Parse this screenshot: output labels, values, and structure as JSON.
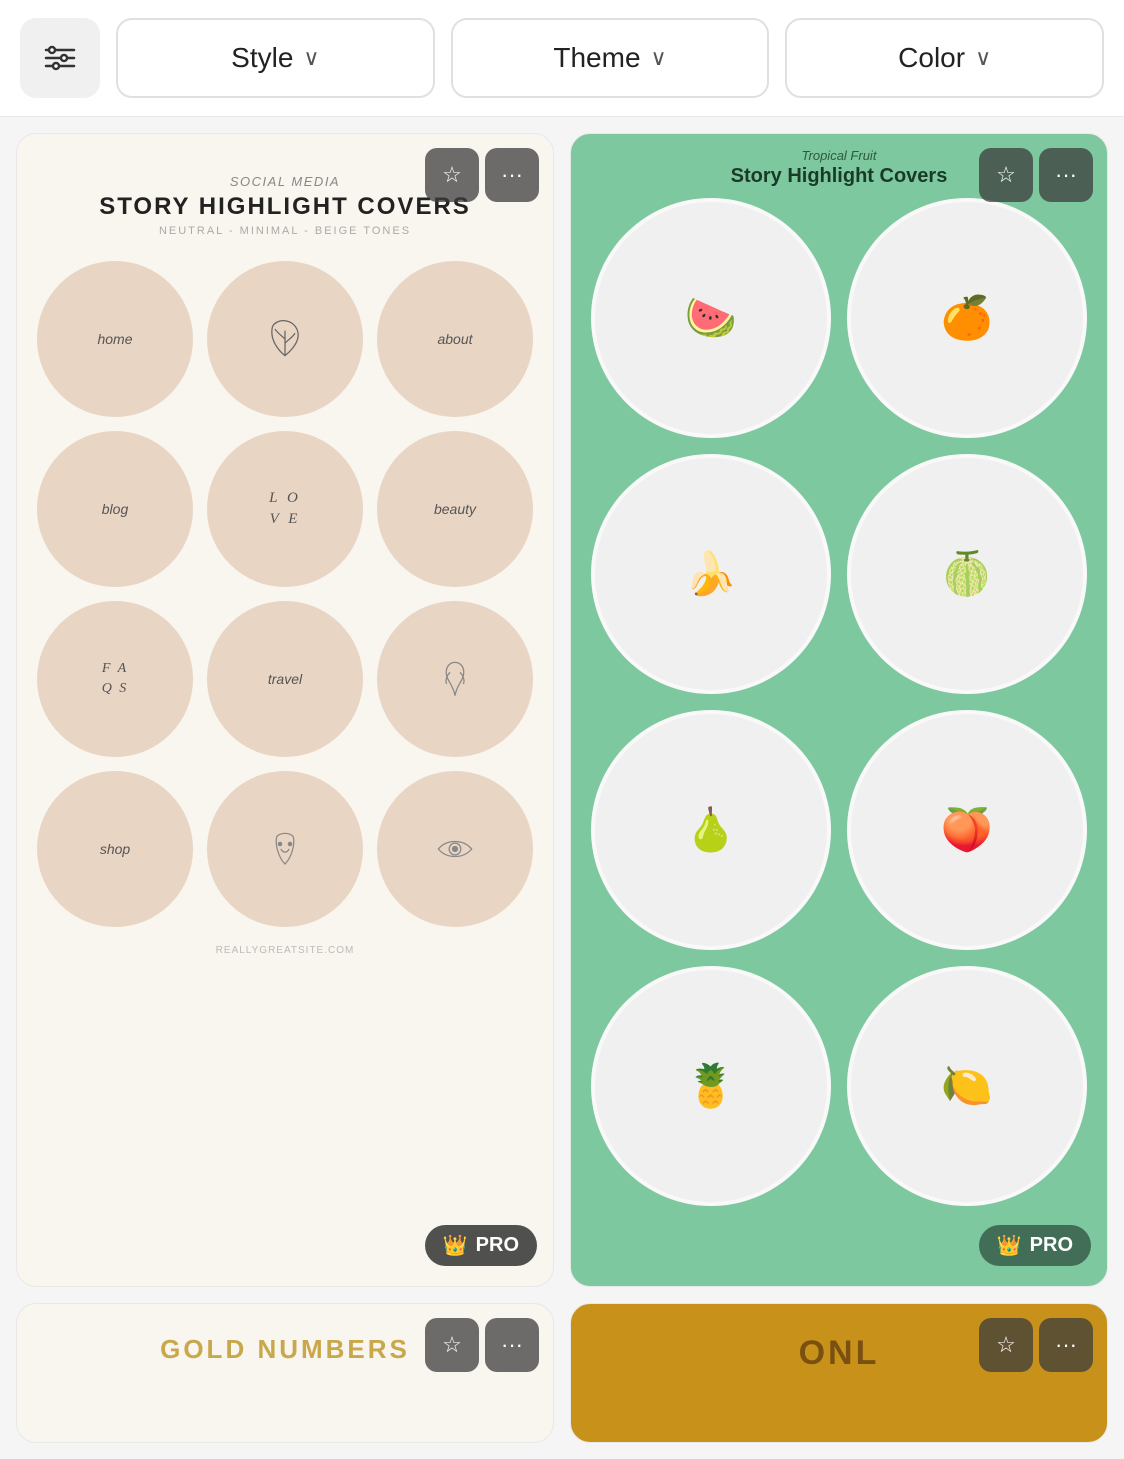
{
  "filterBar": {
    "iconBtn": {
      "ariaLabel": "Filters"
    },
    "buttons": [
      {
        "id": "style-btn",
        "label": "Style",
        "hasChevron": true
      },
      {
        "id": "theme-btn",
        "label": "Theme",
        "hasChevron": true
      },
      {
        "id": "color-btn",
        "label": "Color",
        "hasChevron": true
      }
    ]
  },
  "cards": [
    {
      "id": "card-neutral-highlights",
      "type": "neutral",
      "subtitle": "Social Media",
      "title": "STORY HIGHLIGHT COVERS",
      "description": "NEUTRAL - MINIMAL - BEIGE TONES",
      "footer": "REALLYGREATSITE.COM",
      "proBadge": "PRO",
      "circles": [
        {
          "label": "home",
          "type": "text"
        },
        {
          "label": "🌿",
          "type": "leaf"
        },
        {
          "label": "about",
          "type": "text"
        },
        {
          "label": "blog",
          "type": "text"
        },
        {
          "label": "LO\nVE",
          "type": "text-lines"
        },
        {
          "label": "beauty",
          "type": "text"
        },
        {
          "label": "FA\nQS",
          "type": "text-lines"
        },
        {
          "label": "travel",
          "type": "text"
        },
        {
          "label": "♡",
          "type": "body"
        },
        {
          "label": "shop",
          "type": "text"
        },
        {
          "label": "☽",
          "type": "face"
        },
        {
          "label": "👁",
          "type": "eye"
        }
      ]
    },
    {
      "id": "card-tropical-highlights",
      "type": "tropical",
      "subtitle": "Tropical Fruit",
      "title": "Story Highlight Covers",
      "proBadge": "PRO",
      "fruits": [
        "🍉",
        "🍊",
        "🍌",
        "🍈",
        "🍐",
        "🍑",
        "🍍",
        "🍋"
      ]
    },
    {
      "id": "card-gold-numbers",
      "type": "gold",
      "title": "GOLD NUMBERS",
      "proBadge": null
    },
    {
      "id": "card-onl",
      "type": "dark-gold",
      "title": "ONL",
      "proBadge": null
    }
  ],
  "actions": {
    "starLabel": "☆",
    "moreLabel": "···"
  }
}
